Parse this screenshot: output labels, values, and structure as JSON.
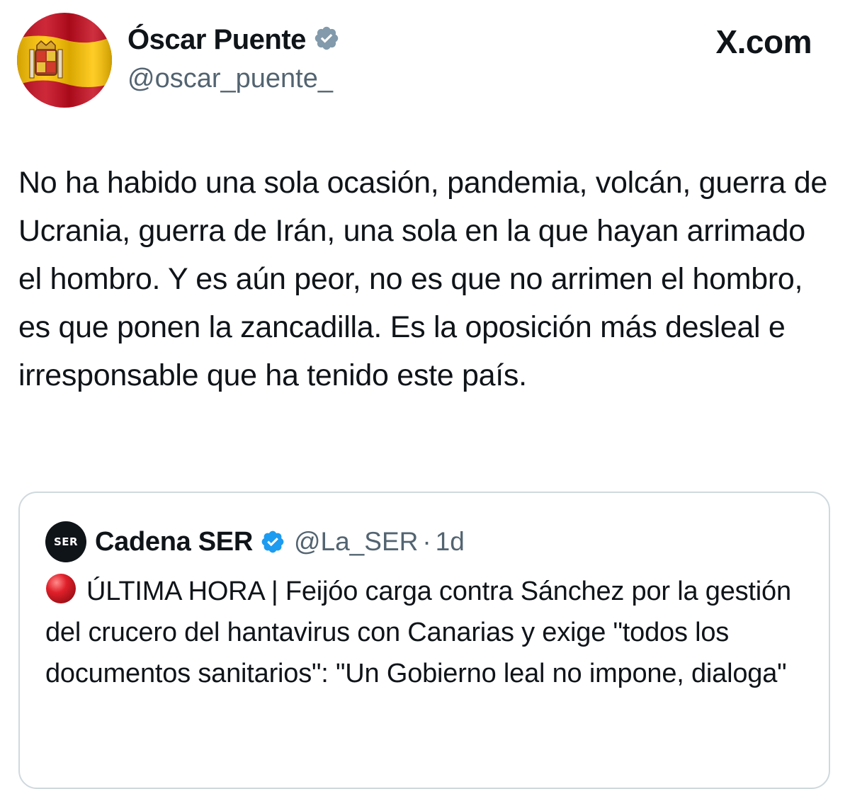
{
  "author": {
    "display_name": "Óscar Puente",
    "handle": "@oscar_puente_",
    "avatar_icon": "spanish-flag-icon",
    "verified_icon": "verified-badge-icon"
  },
  "brand": {
    "label": "X.com"
  },
  "tweet": {
    "text": "No ha habido una sola ocasión, pandemia, volcán, guerra de Ucrania,  guerra de Irán, una sola en la que hayan arrimado el hombro. Y es aún peor, no es que no arrimen el hombro, es que ponen la zancadilla. Es la oposición más desleal e irresponsable que ha tenido este país."
  },
  "quoted_tweet": {
    "logo_text": "SER",
    "display_name": "Cadena SER",
    "handle": "@La_SER",
    "separator": "·",
    "time": "1d",
    "status_icon": "red-circle-icon",
    "text": "ÚLTIMA HORA | Feijóo carga contra Sánchez por la gestión del crucero del hantavirus con Canarias y exige \"todos los documentos sanitarios\": \"Un Gobierno leal no impone, dialoga\""
  },
  "colors": {
    "text_primary": "#0f1419",
    "text_secondary": "#536471",
    "verified_blue": "#1d9bf0",
    "verified_gray": "#829aab",
    "border": "#cfd9de",
    "flag_red": "#c60b1e",
    "flag_yellow": "#ffc400",
    "status_red": "#e0202a"
  }
}
